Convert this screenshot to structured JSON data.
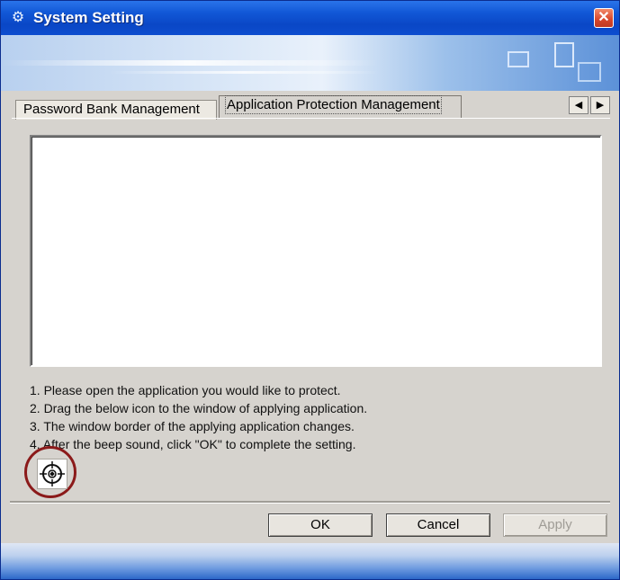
{
  "window": {
    "title": "System Setting",
    "close_glyph": "✕",
    "accent": "#0a47c6"
  },
  "tabs": [
    {
      "label": "Password Bank Management",
      "active": false
    },
    {
      "label": "Application Protection Management",
      "active": true
    }
  ],
  "tab_scroll": {
    "left": "◀",
    "right": "▶"
  },
  "instructions": [
    "1. Please open the application you would like to protect.",
    "2. Drag the below icon to the window of applying application.",
    "3. The window border of the applying application changes.",
    "4. After the beep sound, click \"OK\" to complete the setting."
  ],
  "buttons": {
    "ok": "OK",
    "cancel": "Cancel",
    "apply": "Apply"
  },
  "icons": {
    "title": "settings-icon",
    "target": "crosshair-target-icon"
  },
  "colors": {
    "highlight_ring": "#8b1a1a",
    "close_red": "#d7462b"
  }
}
